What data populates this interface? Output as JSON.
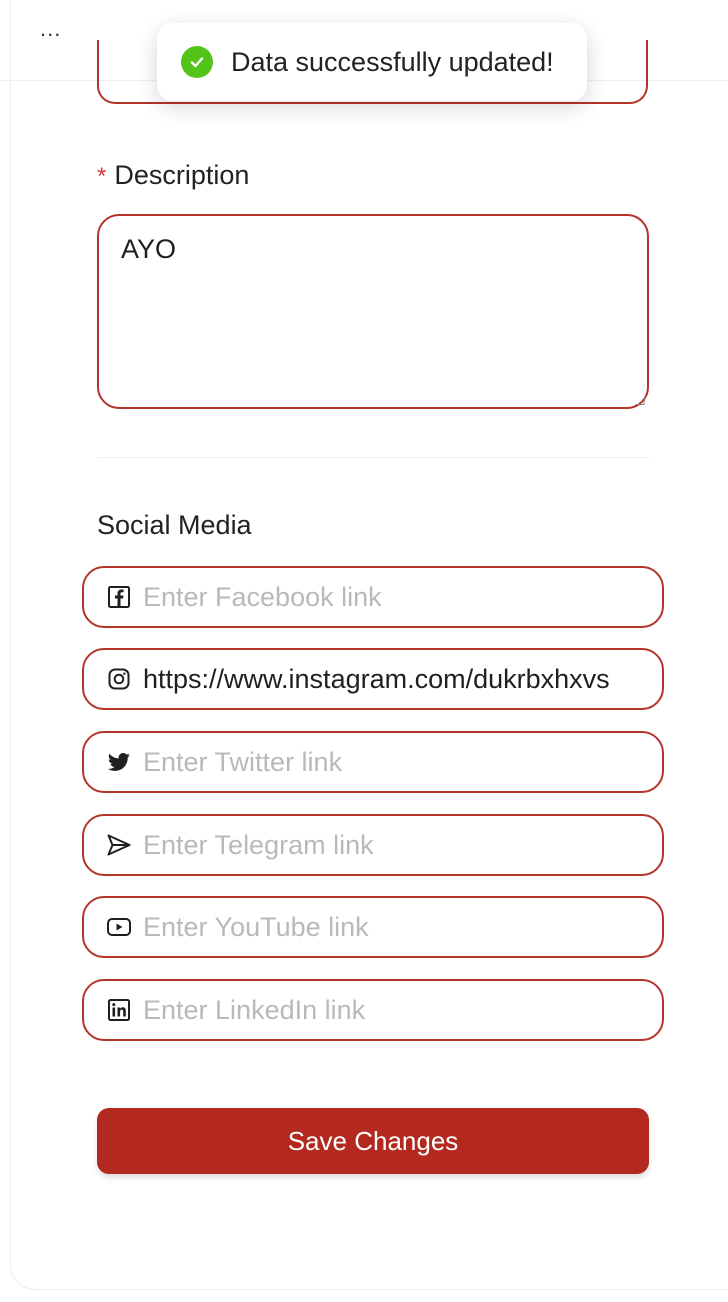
{
  "toast": {
    "message": "Data successfully updated!",
    "status": "success",
    "icon": "check-circle-icon",
    "color": "#52c41a"
  },
  "topbar": {
    "more_label": "..."
  },
  "description": {
    "required_mark": "*",
    "label": "Description",
    "value": "AYO"
  },
  "social": {
    "title": "Social Media",
    "fields": [
      {
        "name": "facebook",
        "icon": "facebook-icon",
        "placeholder": "Enter Facebook link",
        "value": ""
      },
      {
        "name": "instagram",
        "icon": "instagram-icon",
        "placeholder": "",
        "value": "https://www.instagram.com/dukrbxhxvs"
      },
      {
        "name": "twitter",
        "icon": "twitter-icon",
        "placeholder": "Enter Twitter link",
        "value": ""
      },
      {
        "name": "telegram",
        "icon": "telegram-icon",
        "placeholder": "Enter Telegram link",
        "value": ""
      },
      {
        "name": "youtube",
        "icon": "youtube-icon",
        "placeholder": "Enter YouTube link",
        "value": ""
      },
      {
        "name": "linkedin",
        "icon": "linkedin-icon",
        "placeholder": "Enter LinkedIn link",
        "value": ""
      }
    ]
  },
  "actions": {
    "save_label": "Save Changes"
  },
  "colors": {
    "accent": "#b3281f",
    "border": "#b5342a",
    "required": "#d9363e",
    "placeholder": "#b9b9b9"
  }
}
